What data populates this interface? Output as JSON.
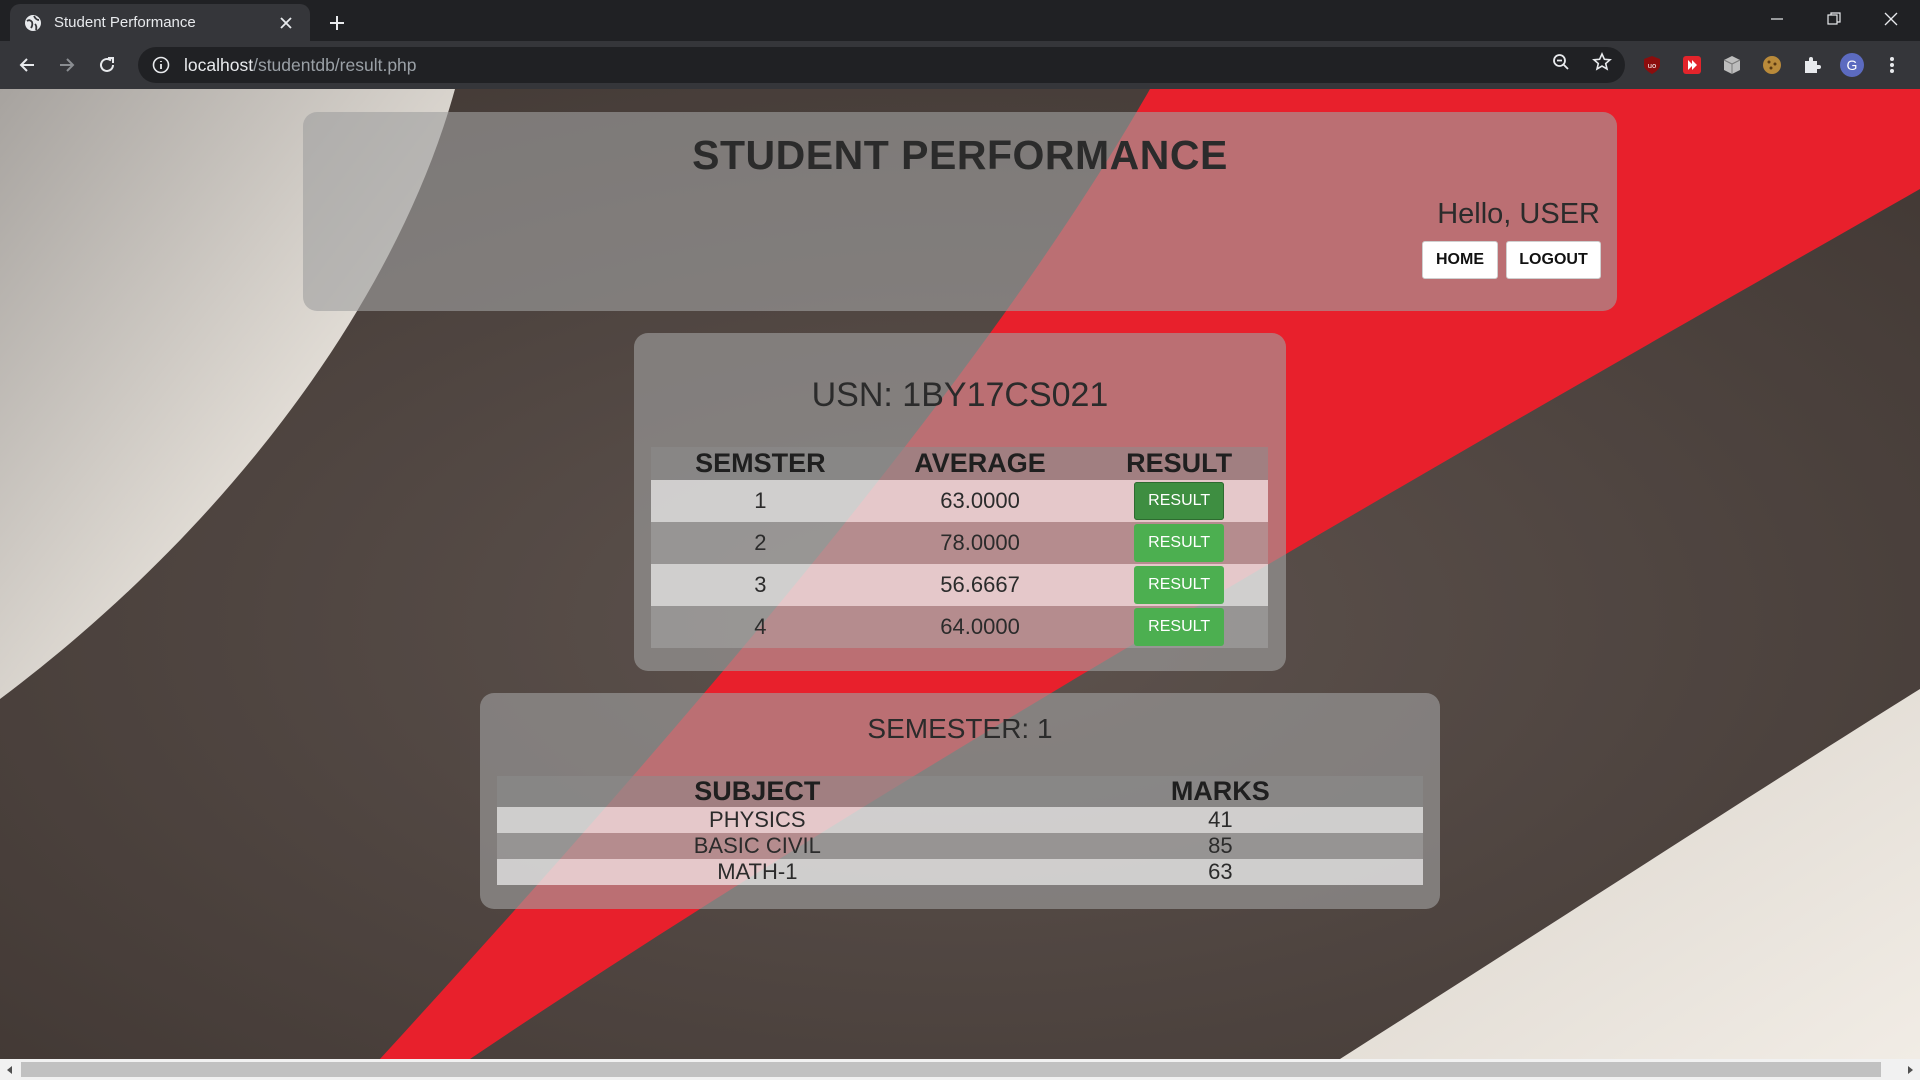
{
  "browser": {
    "tab_title": "Student Performance",
    "url_host": "localhost",
    "url_path": "/studentdb/result.php",
    "profile_initial": "G"
  },
  "header": {
    "title": "STUDENT PERFORMANCE",
    "greeting": "Hello, USER",
    "home_label": "HOME",
    "logout_label": "LOGOUT"
  },
  "summary": {
    "usn": "USN: 1BY17CS021",
    "columns": [
      "SEMSTER",
      "AVERAGE",
      "RESULT"
    ],
    "rows": [
      {
        "semester": "1",
        "average": "63.0000",
        "button": "RESULT"
      },
      {
        "semester": "2",
        "average": "78.0000",
        "button": "RESULT"
      },
      {
        "semester": "3",
        "average": "56.6667",
        "button": "RESULT"
      },
      {
        "semester": "4",
        "average": "64.0000",
        "button": "RESULT"
      }
    ]
  },
  "semester_detail": {
    "title": "SEMESTER: 1",
    "columns": [
      "SUBJECT",
      "MARKS"
    ],
    "rows": [
      {
        "subject": "PHYSICS",
        "marks": "41"
      },
      {
        "subject": "BASIC CIVIL",
        "marks": "85"
      },
      {
        "subject": "MATH-1",
        "marks": "63"
      }
    ]
  },
  "colors": {
    "result_button": "#4caf50",
    "accent_red": "#e8202c",
    "chrome_dark": "#202124"
  }
}
